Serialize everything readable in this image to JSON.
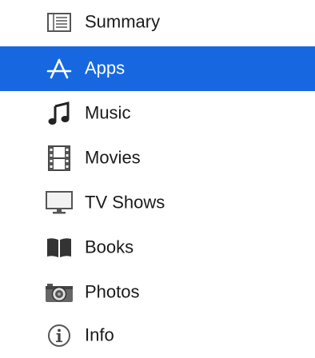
{
  "sidebar": {
    "selected_color": "#1768e0",
    "items": [
      {
        "label": "Summary",
        "icon": "summary-list-icon"
      },
      {
        "label": "Apps",
        "icon": "app-store-icon",
        "selected": true
      },
      {
        "label": "Music",
        "icon": "music-note-icon"
      },
      {
        "label": "Movies",
        "icon": "film-strip-icon"
      },
      {
        "label": "TV Shows",
        "icon": "tv-monitor-icon"
      },
      {
        "label": "Books",
        "icon": "open-book-icon"
      },
      {
        "label": "Photos",
        "icon": "camera-icon"
      },
      {
        "label": "Info",
        "icon": "info-icon"
      }
    ]
  }
}
